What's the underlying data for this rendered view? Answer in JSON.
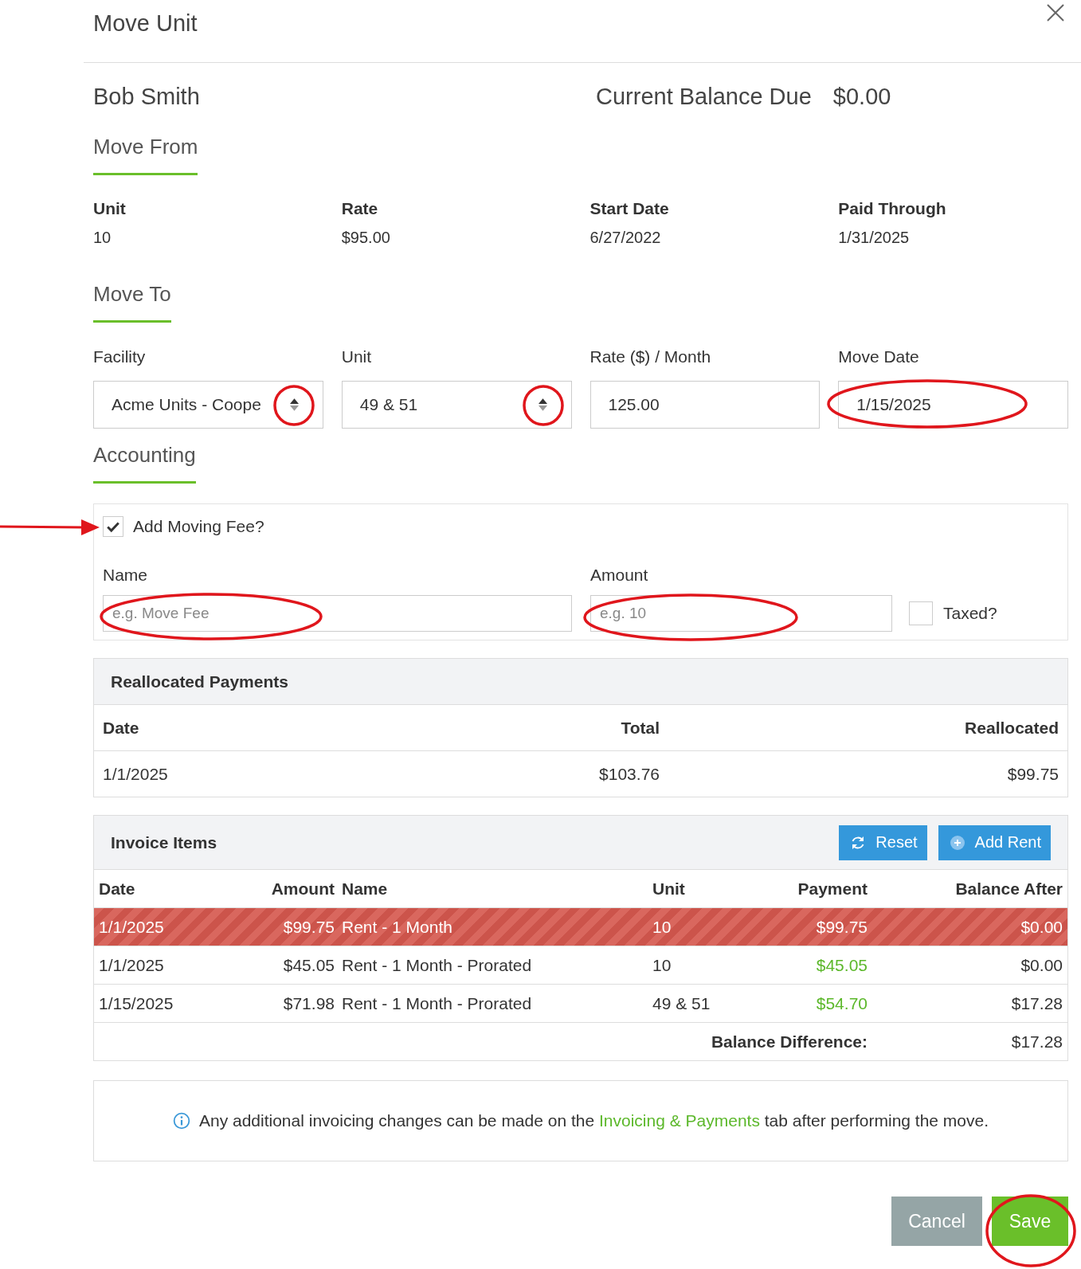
{
  "dialog": {
    "title": "Move Unit"
  },
  "tenant": {
    "name": "Bob Smith",
    "balance_label": "Current Balance Due",
    "balance": "$0.00"
  },
  "move_from": {
    "heading": "Move From",
    "fields": [
      {
        "label": "Unit",
        "value": "10"
      },
      {
        "label": "Rate",
        "value": "$95.00"
      },
      {
        "label": "Start Date",
        "value": "6/27/2022"
      },
      {
        "label": "Paid Through",
        "value": "1/31/2025"
      }
    ]
  },
  "move_to": {
    "heading": "Move To",
    "fields": [
      {
        "kind": "select",
        "label": "Facility",
        "value": "Acme Units - Coope"
      },
      {
        "kind": "select",
        "label": "Unit",
        "value": "49 & 51"
      },
      {
        "kind": "text",
        "label": "Rate ($) / Month",
        "value": "125.00"
      },
      {
        "kind": "text",
        "label": "Move Date",
        "value": "1/15/2025"
      }
    ]
  },
  "accounting": {
    "heading": "Accounting",
    "moving_fee": {
      "label": "Add Moving Fee?",
      "checked": true
    },
    "name": {
      "label": "Name",
      "placeholder": "e.g. Move Fee"
    },
    "amount": {
      "label": "Amount",
      "placeholder": "e.g. 10"
    },
    "taxed": {
      "label": "Taxed?",
      "checked": false
    }
  },
  "reallocated_payments": {
    "title": "Reallocated Payments",
    "columns": [
      "Date",
      "Total",
      "Reallocated"
    ],
    "rows": [
      [
        "1/1/2025",
        "$103.76",
        "$99.75"
      ]
    ]
  },
  "invoice_items": {
    "title": "Invoice Items",
    "buttons": [
      {
        "kind": "reset",
        "label": "Reset"
      },
      {
        "kind": "add",
        "label": "Add Rent"
      }
    ],
    "columns": [
      "Date",
      "Amount",
      "Name",
      "Unit",
      "Payment",
      "Balance After"
    ],
    "rows": [
      {
        "date": "1/1/2025",
        "amount": "$99.75",
        "name": "Rent - 1 Month",
        "unit": "10",
        "payment": "$99.75",
        "balance_after": "$0.00",
        "flagged": true
      },
      {
        "date": "1/1/2025",
        "amount": "$45.05",
        "name": "Rent - 1 Month - Prorated",
        "unit": "10",
        "payment": "$45.05",
        "balance_after": "$0.00",
        "flagged": false
      },
      {
        "date": "1/15/2025",
        "amount": "$71.98",
        "name": "Rent - 1 Month - Prorated",
        "unit": "49 & 51",
        "payment": "$54.70",
        "balance_after": "$17.28",
        "flagged": false
      }
    ],
    "balance_difference": {
      "label": "Balance Difference:",
      "value": "$17.28"
    }
  },
  "notice": {
    "before": "Any additional invoicing changes can be made on the ",
    "link": "Invoicing & Payments",
    "after": " tab after performing the move."
  },
  "buttons": [
    {
      "kind": "cancel",
      "label": "Cancel"
    },
    {
      "kind": "save",
      "label": "Save"
    }
  ]
}
